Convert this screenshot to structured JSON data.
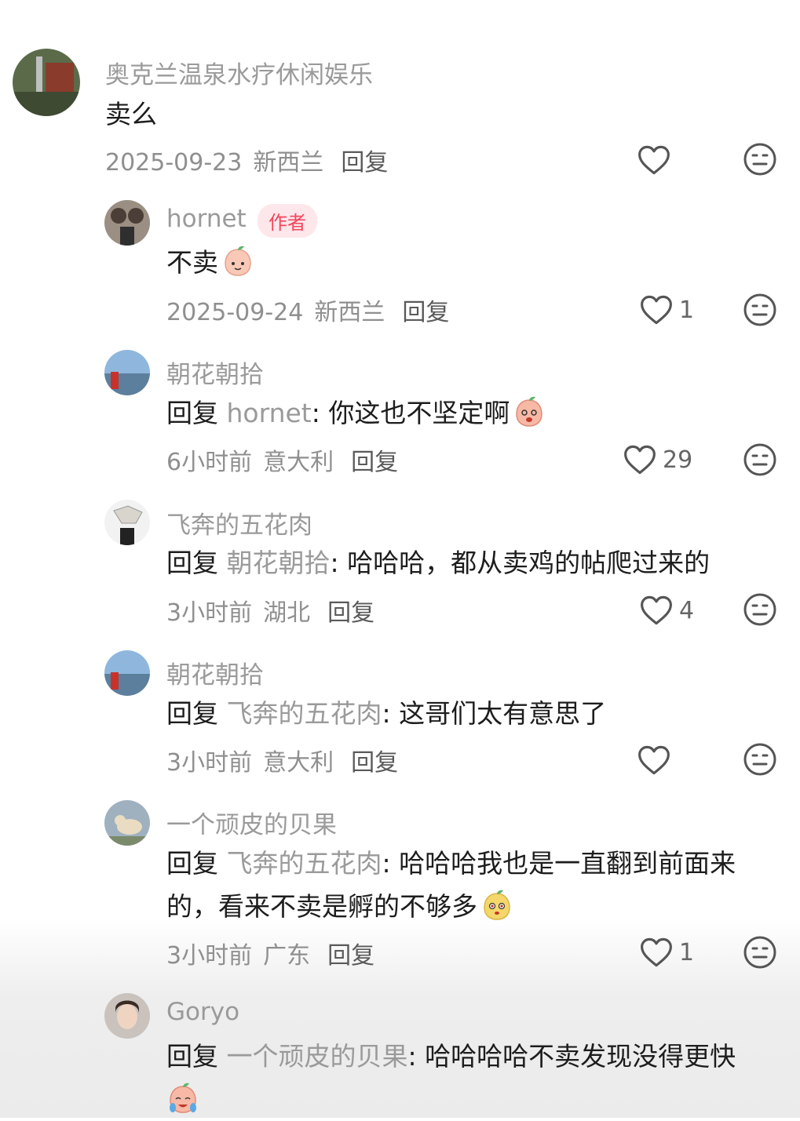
{
  "comments": [
    {
      "username": "奥克兰温泉水疗休闲娱乐",
      "text": "卖么",
      "date": "2025-09-23",
      "location": "新西兰",
      "reply_label": "回复",
      "likes": ""
    },
    {
      "username": "hornet",
      "badge": "作者",
      "text": "不卖",
      "date": "2025-09-24",
      "location": "新西兰",
      "reply_label": "回复",
      "likes": "1"
    },
    {
      "username": "朝花朝拾",
      "reply_prefix": "回复",
      "reply_to": "hornet",
      "text": ": 你这也不坚定啊",
      "date": "6小时前",
      "location": "意大利",
      "reply_label": "回复",
      "likes": "29"
    },
    {
      "username": "飞奔的五花肉",
      "reply_prefix": "回复",
      "reply_to": "朝花朝拾",
      "text": ": 哈哈哈，都从卖鸡的帖爬过来的",
      "date": "3小时前",
      "location": "湖北",
      "reply_label": "回复",
      "likes": "4"
    },
    {
      "username": "朝花朝拾",
      "reply_prefix": "回复",
      "reply_to": "飞奔的五花肉",
      "text": ": 这哥们太有意思了",
      "date": "3小时前",
      "location": "意大利",
      "reply_label": "回复",
      "likes": ""
    },
    {
      "username": "一个顽皮的贝果",
      "reply_prefix": "回复",
      "reply_to": "飞奔的五花肉",
      "text": ": 哈哈哈我也是一直翻到前面来",
      "text2": "的，看来不卖是孵的不够多",
      "date": "3小时前",
      "location": "广东",
      "reply_label": "回复",
      "likes": "1"
    },
    {
      "username": "Goryo",
      "reply_prefix": "回复",
      "reply_to": "一个顽皮的贝果",
      "text": ": 哈哈哈哈不卖发现没得更快"
    }
  ],
  "icons": {
    "like": "heart-outline-icon",
    "dislike": "neutral-face-icon",
    "emoji": "peach-face-emoji"
  },
  "colors": {
    "author_badge_bg": "#fde7eb",
    "author_badge_text": "#f2465c",
    "username": "#9a9a9a"
  }
}
